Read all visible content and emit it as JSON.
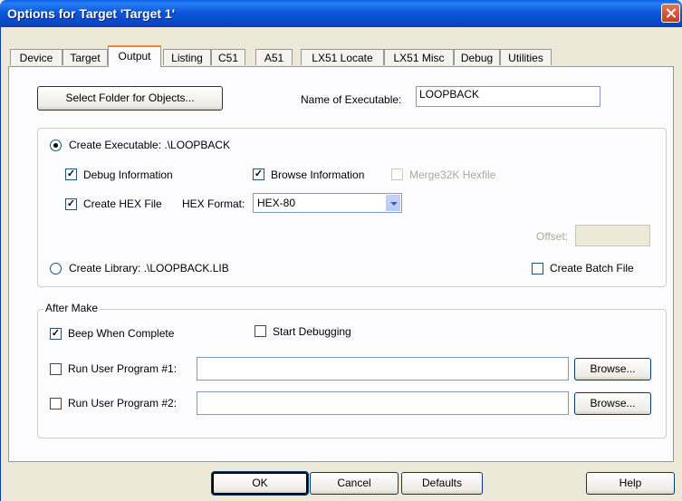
{
  "window": {
    "title": "Options for Target 'Target 1'"
  },
  "tabs": [
    "Device",
    "Target",
    "Output",
    "Listing",
    "C51",
    "A51",
    "LX51 Locate",
    "LX51 Misc",
    "Debug",
    "Utilities"
  ],
  "active_tab": "Output",
  "output": {
    "select_folder_label": "Select Folder for Objects...",
    "name_exec_label": "Name of Executable:",
    "name_exec_value": "LOOPBACK",
    "create_exec_label": "Create Executable:  .\\LOOPBACK",
    "create_exec_selected": true,
    "debug_info_label": "Debug Information",
    "debug_info_checked": true,
    "browse_info_label": "Browse Information",
    "browse_info_checked": true,
    "merge_label": "Merge32K Hexfile",
    "merge_checked": false,
    "create_hex_label": "Create HEX File",
    "create_hex_checked": true,
    "hex_format_label": "HEX Format:",
    "hex_format_value": "HEX-80",
    "offset_label": "Offset:",
    "create_lib_label": "Create Library:  .\\LOOPBACK.LIB",
    "create_batch_label": "Create Batch File",
    "create_batch_checked": false
  },
  "after_make": {
    "legend": "After Make",
    "beep_label": "Beep When Complete",
    "beep_checked": true,
    "start_debug_label": "Start Debugging",
    "start_debug_checked": false,
    "run1_label": "Run User Program #1:",
    "run1_checked": false,
    "run1_value": "",
    "run2_label": "Run User Program #2:",
    "run2_checked": false,
    "run2_value": "",
    "browse_label": "Browse..."
  },
  "footer": {
    "ok": "OK",
    "cancel": "Cancel",
    "defaults": "Defaults",
    "help": "Help"
  }
}
